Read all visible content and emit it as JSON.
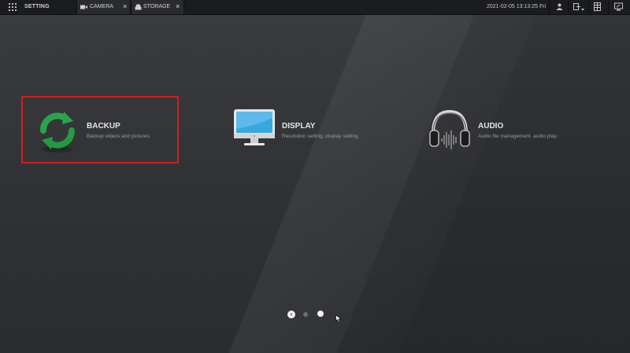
{
  "topbar": {
    "title": "SETTING",
    "tabs": [
      {
        "label": "CAMERA",
        "icon": "camera-icon",
        "close": "×"
      },
      {
        "label": "STORAGE",
        "icon": "storage-icon",
        "close": "×"
      }
    ],
    "datetime": "2021-02-05 13:13:25 Fri"
  },
  "items": [
    {
      "label": "BACKUP",
      "desc": "Backup videos and pictures.",
      "icon": "backup-sync-icon",
      "selected": true
    },
    {
      "label": "DISPLAY",
      "desc": "Resolution setting, display setting.",
      "icon": "monitor-icon"
    },
    {
      "label": "AUDIO",
      "desc": "Audio file management, audio play.",
      "icon": "headphones-icon"
    }
  ],
  "pager": {
    "prev": "‹",
    "current_page": 2,
    "total_pages": 2
  },
  "colors": {
    "selection": "#d21f22",
    "backup_green": "#2aa34a",
    "display_blue": "#3aa6e0"
  }
}
